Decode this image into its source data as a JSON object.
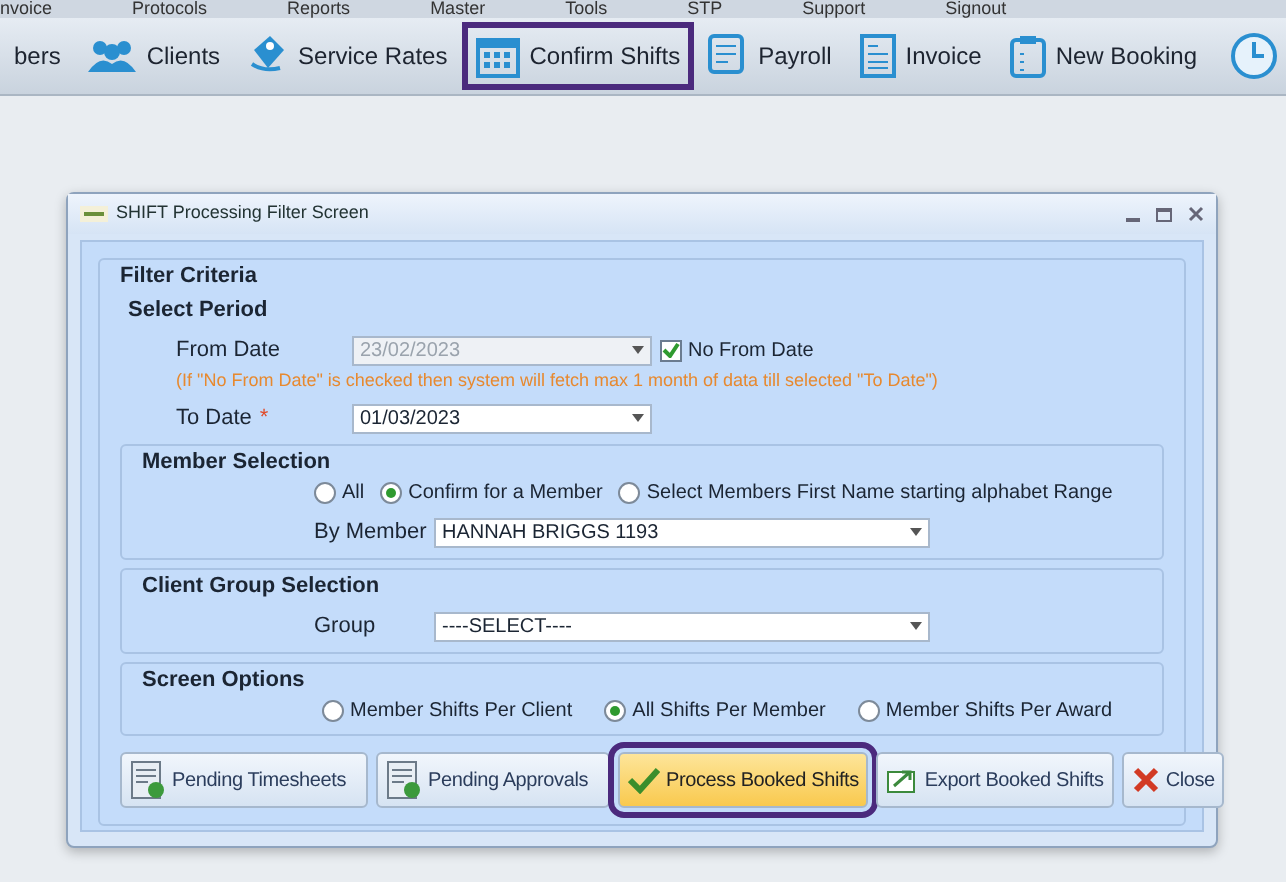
{
  "menu": [
    {
      "label": "nvoice"
    },
    {
      "label": "Protocols"
    },
    {
      "label": "Reports"
    },
    {
      "label": "Master"
    },
    {
      "label": "Tools"
    },
    {
      "label": "STP"
    },
    {
      "label": "Support"
    },
    {
      "label": "Signout"
    }
  ],
  "toolbar": [
    {
      "label": "bers",
      "kind": "none",
      "highlighted": false
    },
    {
      "label": "Clients",
      "kind": "people",
      "highlighted": false
    },
    {
      "label": "Service Rates",
      "kind": "tag",
      "highlighted": false
    },
    {
      "label": "Confirm Shifts",
      "kind": "calendar",
      "highlighted": true
    },
    {
      "label": "Payroll",
      "kind": "document",
      "highlighted": false
    },
    {
      "label": "Invoice",
      "kind": "invoice",
      "highlighted": false
    },
    {
      "label": "New Booking",
      "kind": "clipboard",
      "highlighted": false
    }
  ],
  "dialog": {
    "title": "SHIFT Processing Filter Screen",
    "filter_criteria": {
      "title": "Filter Criteria",
      "period_title": "Select Period",
      "from_label": "From Date",
      "from_value": "23/02/2023",
      "from_disabled": true,
      "no_from_date": {
        "label": "No From Date",
        "checked": true
      },
      "note": "(If \"No From Date\" is checked then system will fetch max 1 month of data till selected \"To Date\")",
      "to_label": "To Date",
      "required_mark": "*",
      "to_value": "01/03/2023"
    },
    "member_selection": {
      "title": "Member Selection",
      "options": [
        {
          "label": "All",
          "selected": false
        },
        {
          "label": "Confirm for a Member",
          "selected": true
        },
        {
          "label": "Select Members First Name starting alphabet Range",
          "selected": false
        }
      ],
      "by_member_label": "By Member",
      "by_member_value": "HANNAH BRIGGS 1193"
    },
    "client_group": {
      "title": "Client Group Selection",
      "group_label": "Group",
      "group_value": "----SELECT----"
    },
    "screen_options": {
      "title": "Screen Options",
      "options": [
        {
          "label": "Member Shifts Per Client",
          "selected": false
        },
        {
          "label": "All Shifts Per Member",
          "selected": true
        },
        {
          "label": "Member Shifts Per Award",
          "selected": false
        }
      ]
    },
    "buttons": [
      {
        "label": "Pending Timesheets",
        "kind": "sheet",
        "highlighted": false
      },
      {
        "label": "Pending Approvals",
        "kind": "sheet",
        "highlighted": false
      },
      {
        "label": "Process Booked Shifts",
        "kind": "check",
        "highlighted": true
      },
      {
        "label": "Export Booked Shifts",
        "kind": "export",
        "highlighted": false
      },
      {
        "label": "Close",
        "kind": "close",
        "highlighted": false
      }
    ]
  }
}
